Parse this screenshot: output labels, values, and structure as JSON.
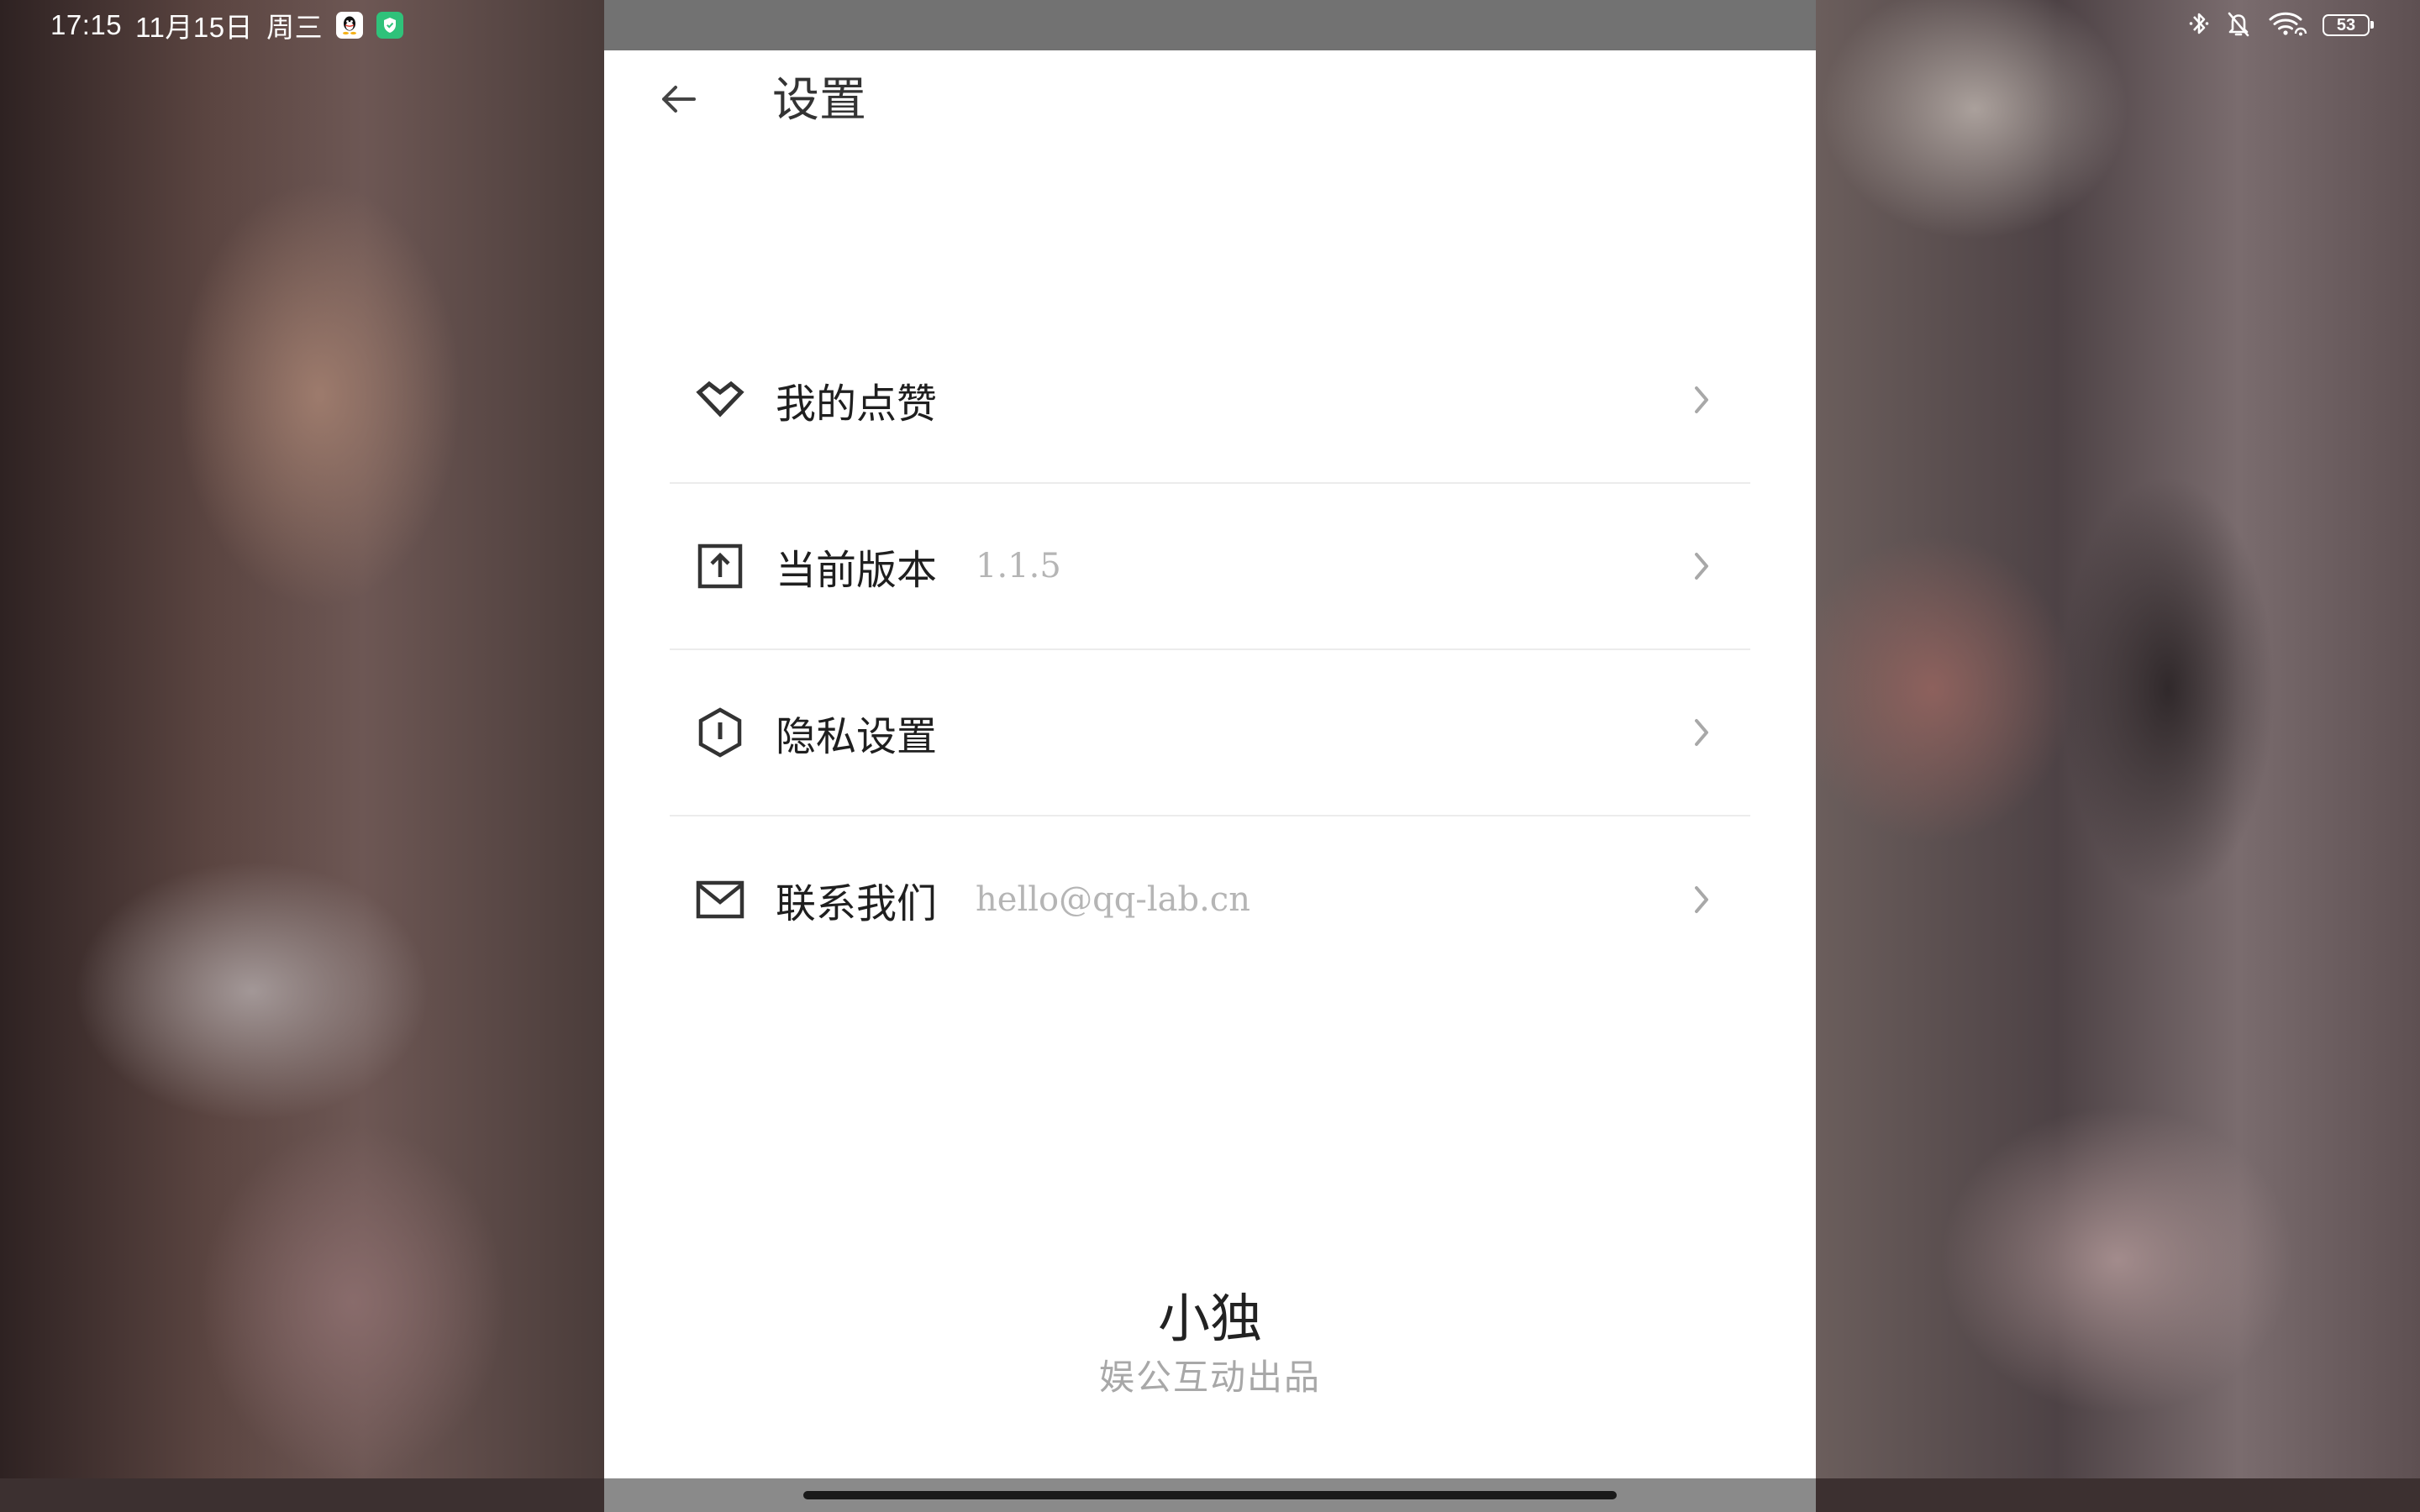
{
  "status_bar": {
    "time": "17:15",
    "date": "11月15日",
    "weekday": "周三",
    "battery_level": "53",
    "left_icons": [
      "qq-icon",
      "shield-app-icon"
    ],
    "right_icons": [
      "bluetooth-icon",
      "silent-bell-icon",
      "wifi-icon",
      "battery-icon"
    ]
  },
  "header": {
    "title": "设置",
    "back_icon": "arrow-left-icon"
  },
  "settings": {
    "items": [
      {
        "label": "我的点赞",
        "value": "",
        "icon": "heart-outline-icon"
      },
      {
        "label": "当前版本",
        "value": "1.1.5",
        "icon": "upload-box-icon"
      },
      {
        "label": "隐私设置",
        "value": "",
        "icon": "hexagon-info-icon"
      },
      {
        "label": "联系我们",
        "value": "hello@qq-lab.cn",
        "icon": "mail-icon"
      }
    ]
  },
  "footer": {
    "app_name": "小独",
    "publisher": "娱公互动出品"
  },
  "colors": {
    "panel_background": "#ffffff",
    "text_primary": "#1f1f1f",
    "text_secondary": "#b5b5b5",
    "divider": "#ececec",
    "icon": "#333333"
  }
}
